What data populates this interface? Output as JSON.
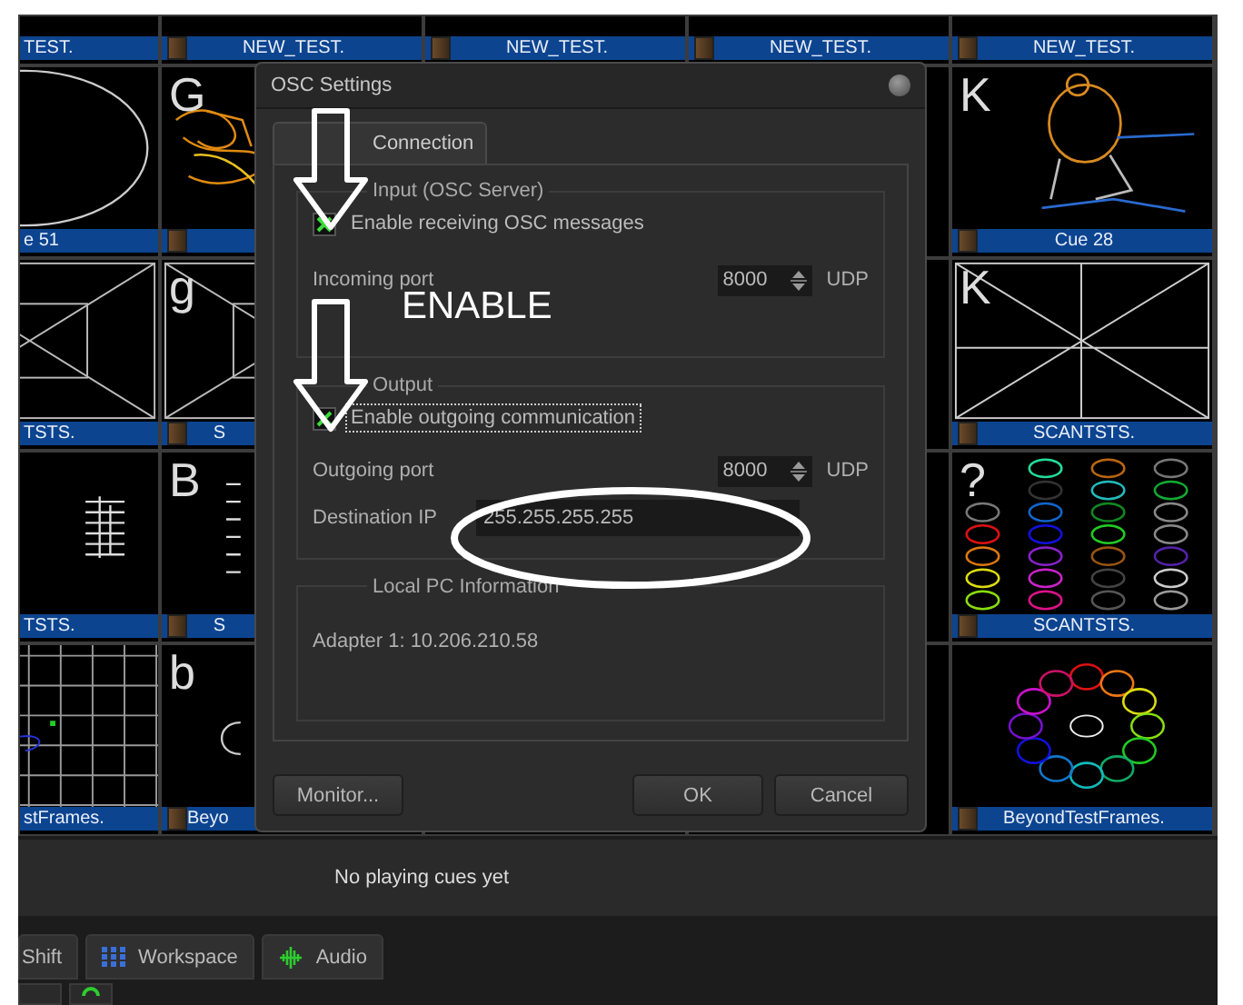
{
  "tiles": {
    "rows": [
      [
        {
          "kind": "blank",
          "label": "TEST."
        },
        {
          "kind": "blank",
          "label": "NEW_TEST."
        },
        {
          "kind": "blank",
          "label": "NEW_TEST."
        },
        {
          "kind": "blank",
          "label": "NEW_TEST."
        },
        {
          "kind": "blank",
          "label": "NEW_TEST."
        }
      ],
      [
        {
          "kind": "ellipse",
          "label": "e 51"
        },
        {
          "kind": "scribble",
          "letter": "G"
        },
        {
          "kind": "covered"
        },
        {
          "kind": "covered"
        },
        {
          "kind": "figure",
          "letter": "K",
          "label": "Cue 28"
        }
      ],
      [
        {
          "kind": "cross",
          "label": "TSTS."
        },
        {
          "kind": "cross",
          "letter": "g",
          "label": "S"
        },
        {
          "kind": "covered"
        },
        {
          "kind": "covered"
        },
        {
          "kind": "star",
          "letter": "K",
          "label": "SCANTSTS."
        }
      ],
      [
        {
          "kind": "ladder",
          "label": "TSTS."
        },
        {
          "kind": "ticks",
          "letter": "B",
          "label": "S"
        },
        {
          "kind": "covered"
        },
        {
          "kind": "covered"
        },
        {
          "kind": "loops",
          "letter": "?",
          "label": "SCANTSTS."
        }
      ],
      [
        {
          "kind": "grid",
          "label": "stFrames."
        },
        {
          "kind": "arc",
          "letter": "b",
          "label": "Beyo"
        },
        {
          "kind": "covered"
        },
        {
          "kind": "covered"
        },
        {
          "kind": "rings",
          "label": "BeyondTestFrames."
        }
      ]
    ]
  },
  "dialog": {
    "title": "OSC Settings",
    "tabs": [
      {
        "label": "Connection",
        "selected": true
      }
    ],
    "input_group": {
      "title": "Input (OSC Server)",
      "enable": {
        "label": "Enable receiving OSC messages",
        "checked": true,
        "focused": false
      },
      "port_label": "Incoming port",
      "port": "8000",
      "protocol": "UDP"
    },
    "output_group": {
      "title": "Output",
      "enable": {
        "label": "Enable outgoing communication",
        "checked": true,
        "focused": true
      },
      "port_label": "Outgoing port",
      "port": "8000",
      "protocol": "UDP",
      "destination_label": "Destination IP",
      "destination": "255.255.255.255"
    },
    "local_group": {
      "title": "Local PC Information",
      "adapter": "Adapter 1: 10.206.210.58"
    },
    "buttons": [
      "Monitor...",
      "OK",
      "Cancel"
    ]
  },
  "annotation_text": "ENABLE",
  "status_bar": "No playing cues yet",
  "bottom_tabs": [
    {
      "label": "Shift"
    },
    {
      "label": "Workspace"
    },
    {
      "label": "Audio"
    }
  ]
}
